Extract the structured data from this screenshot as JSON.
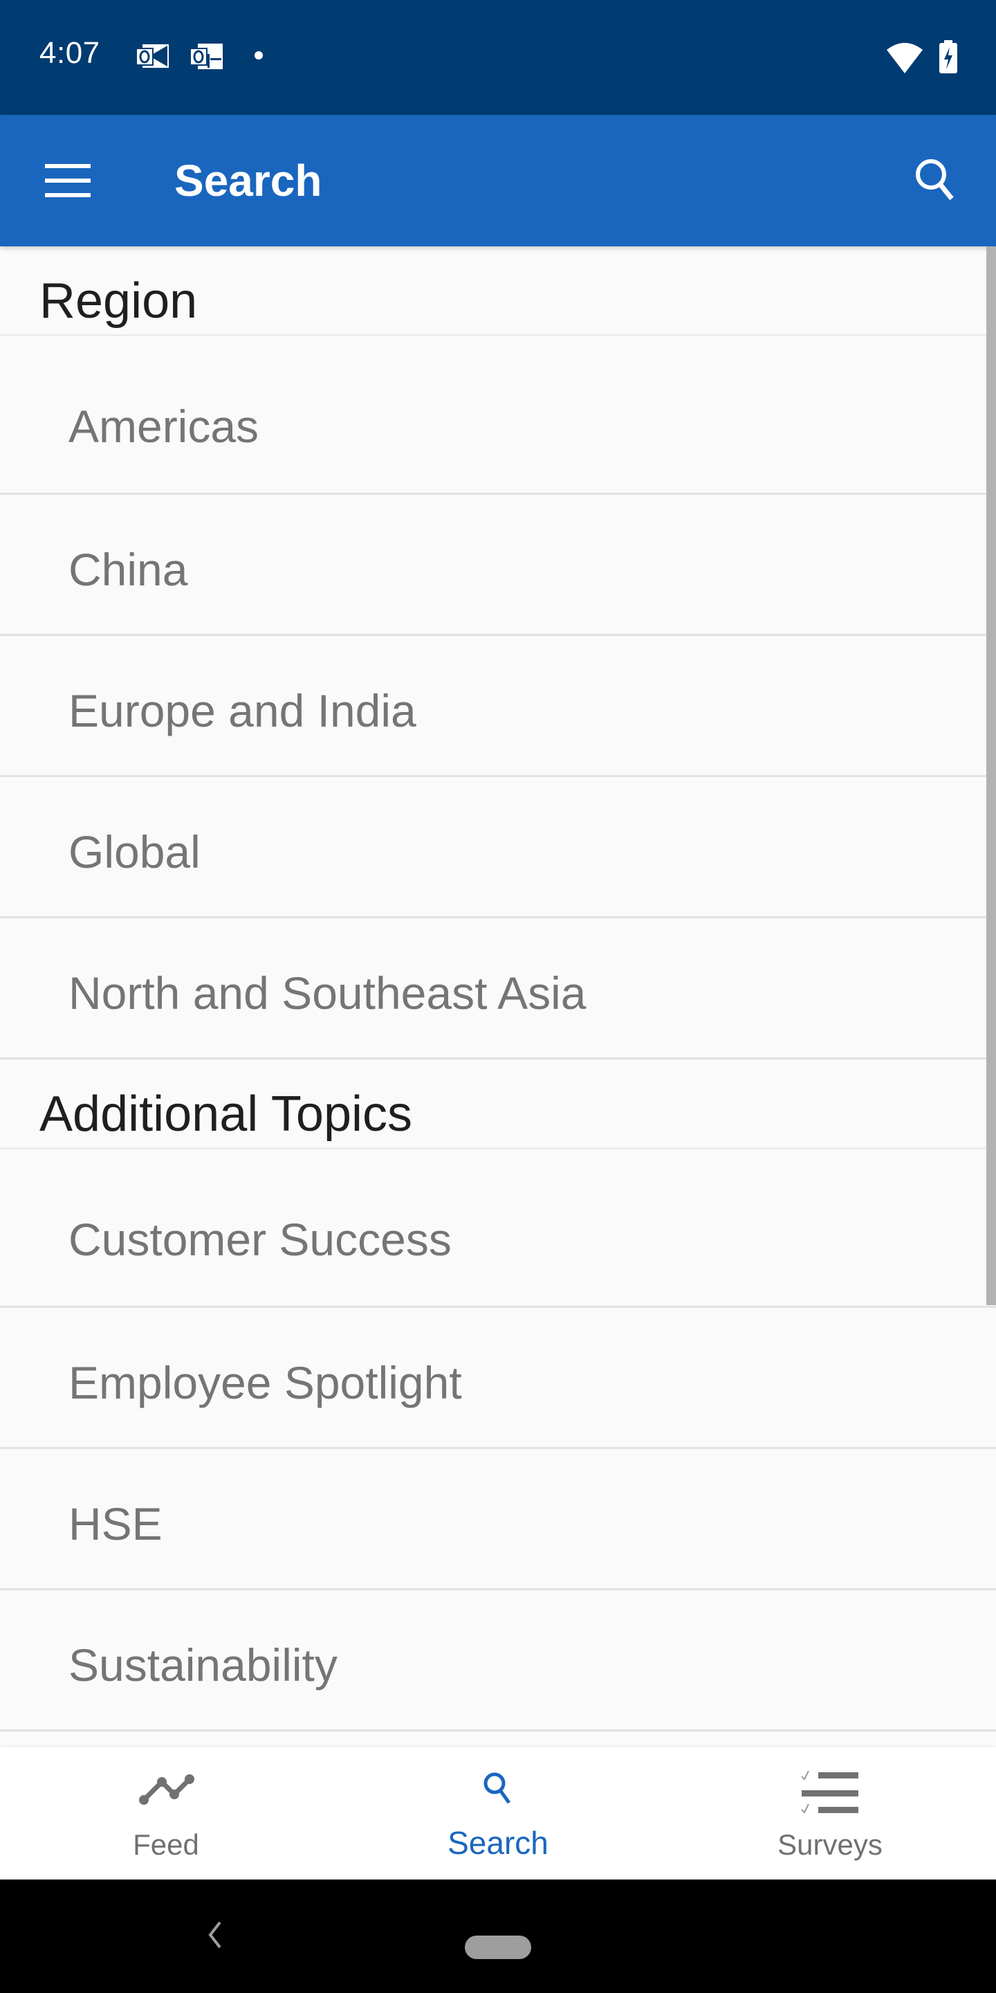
{
  "status_bar": {
    "time": "4:07",
    "notification_icons": [
      "outlook-mail-icon",
      "outlook-calendar-icon",
      "more-notifications-dot"
    ],
    "system_icons": [
      "wifi-icon",
      "battery-charging-icon"
    ]
  },
  "app_bar": {
    "title": "Search",
    "menu_icon": "hamburger-menu-icon",
    "action_icon": "search-icon"
  },
  "sections": [
    {
      "header": "Region",
      "items": [
        "Americas",
        "China",
        "Europe and India",
        "Global",
        "North and Southeast Asia"
      ]
    },
    {
      "header": "Additional Topics",
      "items": [
        "Customer Success",
        "Employee Spotlight",
        "HSE",
        "Sustainability"
      ]
    }
  ],
  "bottom_nav": {
    "items": [
      {
        "label": "Feed",
        "icon": "trend-line-icon",
        "active": false
      },
      {
        "label": "Search",
        "icon": "search-icon",
        "active": true
      },
      {
        "label": "Surveys",
        "icon": "checklist-icon",
        "active": false
      }
    ]
  },
  "colors": {
    "status_bar": "#003b71",
    "app_bar": "#1a66be",
    "accent": "#1a66be",
    "inactive": "#717171",
    "item_text": "#757575",
    "header_text": "#1f1f1f",
    "background": "#fafafa"
  }
}
